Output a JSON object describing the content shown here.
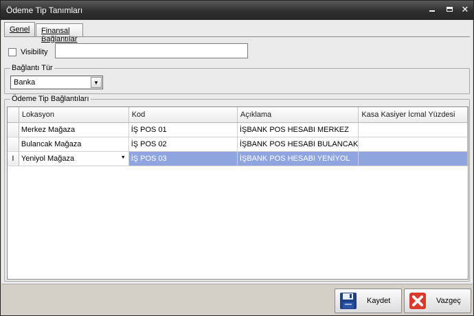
{
  "window": {
    "title": "Ödeme Tip Tanımları"
  },
  "tabs": [
    {
      "label": "Genel"
    },
    {
      "label": "Finansal Bağlantılar"
    }
  ],
  "visibility": {
    "label": "Visibility",
    "checked": false,
    "value": ""
  },
  "baglanti_tur": {
    "group_title": "Bağlantı Tür",
    "selected": "Banka"
  },
  "odeme_tip": {
    "group_title": "Ödeme Tip Bağlantıları",
    "columns": [
      "Lokasyon",
      "Kod",
      "Açıklama",
      "Kasa Kasiyer İcmal Yüzdesi"
    ],
    "rows": [
      {
        "lokasyon": "Merkez Mağaza",
        "kod": "İŞ POS 01",
        "aciklama": "İŞBANK POS HESABI MERKEZ",
        "yuzde": ""
      },
      {
        "lokasyon": "Bulancak Mağaza",
        "kod": "İŞ POS 02",
        "aciklama": "İŞBANK POS HESABI BULANCAK",
        "yuzde": ""
      },
      {
        "lokasyon": "Yeniyol Mağaza",
        "kod": "İŞ POS 03",
        "aciklama": "İŞBANK POS HESABI YENİYOL",
        "yuzde": ""
      }
    ],
    "selected_row_indicator": "I"
  },
  "buttons": {
    "save": "Kaydet",
    "cancel": "Vazgeç"
  },
  "colors": {
    "titlebar": "#2e2e2e",
    "selection": "#8fa5e0",
    "cancel_icon": "#d93a2a",
    "save_icon": "#1f3f86"
  }
}
